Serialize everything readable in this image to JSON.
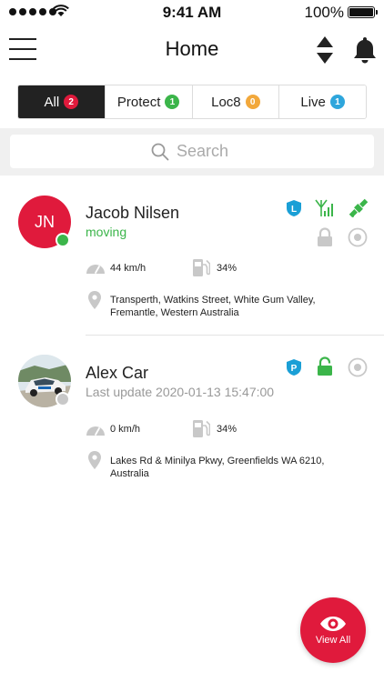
{
  "status_bar": {
    "time": "9:41 AM",
    "battery": "100%"
  },
  "nav": {
    "title": "Home"
  },
  "tabs": [
    {
      "label": "All",
      "count": "2",
      "color": "#e01a3c",
      "active": true
    },
    {
      "label": "Protect",
      "count": "1",
      "color": "#3bb54a",
      "active": false
    },
    {
      "label": "Loc8",
      "count": "0",
      "color": "#f2a83b",
      "active": false
    },
    {
      "label": "Live",
      "count": "1",
      "color": "#2ea6dc",
      "active": false
    }
  ],
  "search": {
    "placeholder": "Search"
  },
  "vehicles": [
    {
      "initials": "JN",
      "name": "Jacob Nilsen",
      "status": "moving",
      "status_color": "#3bb54a",
      "plan_badge": "L",
      "speed": "44 km/h",
      "fuel": "34%",
      "address": "Transperth, Watkins Street, White Gum Valley, Fremantle, Western Australia"
    },
    {
      "name": "Alex Car",
      "status": "Last update 2020-01-13 15:47:00",
      "plan_badge": "P",
      "speed": "0 km/h",
      "fuel": "34%",
      "address": "Lakes Rd & Minilya Pkwy, Greenfields WA 6210, Australia"
    }
  ],
  "fab": {
    "label": "View All"
  },
  "colors": {
    "accent": "#e01a3c",
    "green": "#3bb54a",
    "blue": "#1a9fd6",
    "orange": "#f2a83b"
  }
}
